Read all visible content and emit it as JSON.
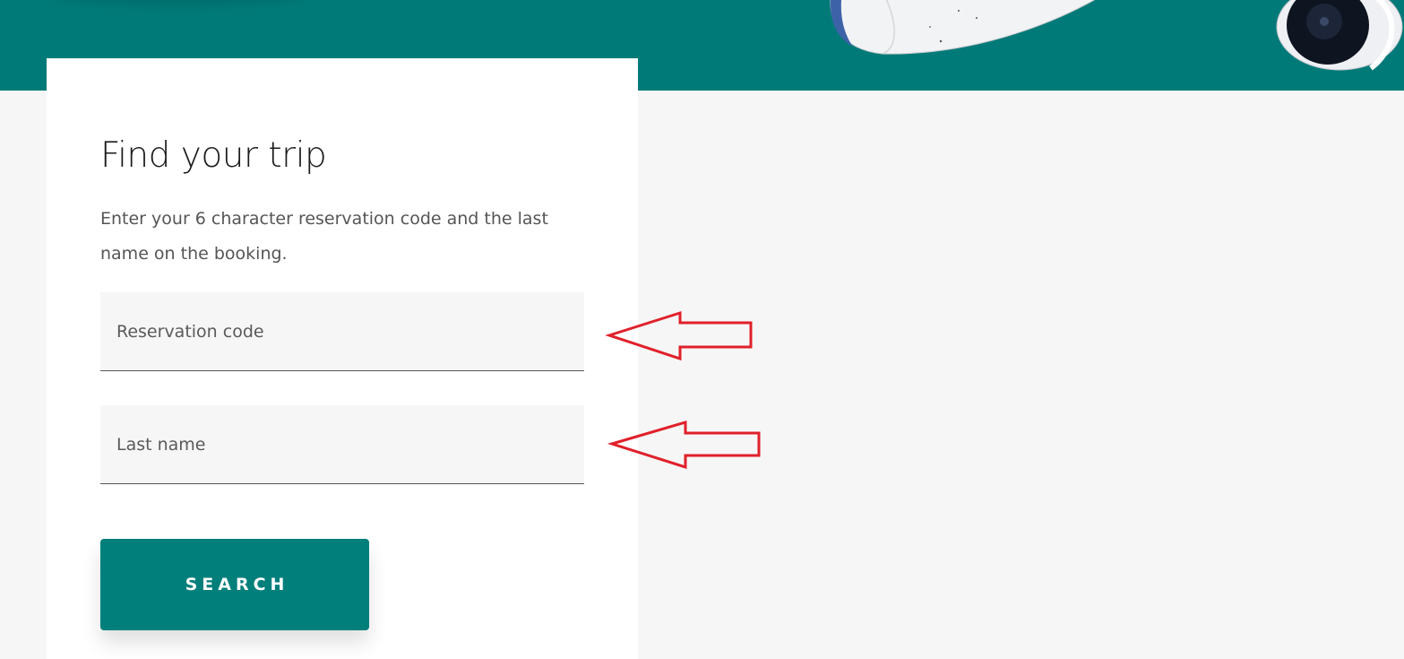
{
  "trip_search": {
    "title": "Find your trip",
    "description": "Enter your 6 character reservation code and the last name on the booking.",
    "fields": {
      "reservation_code": {
        "placeholder": "Reservation code",
        "value": ""
      },
      "last_name": {
        "placeholder": "Last name",
        "value": ""
      }
    },
    "search_label": "SEARCH"
  },
  "colors": {
    "brand_teal": "#007a78",
    "button_teal": "#007f7b",
    "page_background": "#f6f6f6",
    "annotation_arrow": "#e0202a"
  },
  "icons": {
    "hero_image": "airplane-engine-image",
    "annotation_arrows": "red-outline-left-arrow"
  }
}
